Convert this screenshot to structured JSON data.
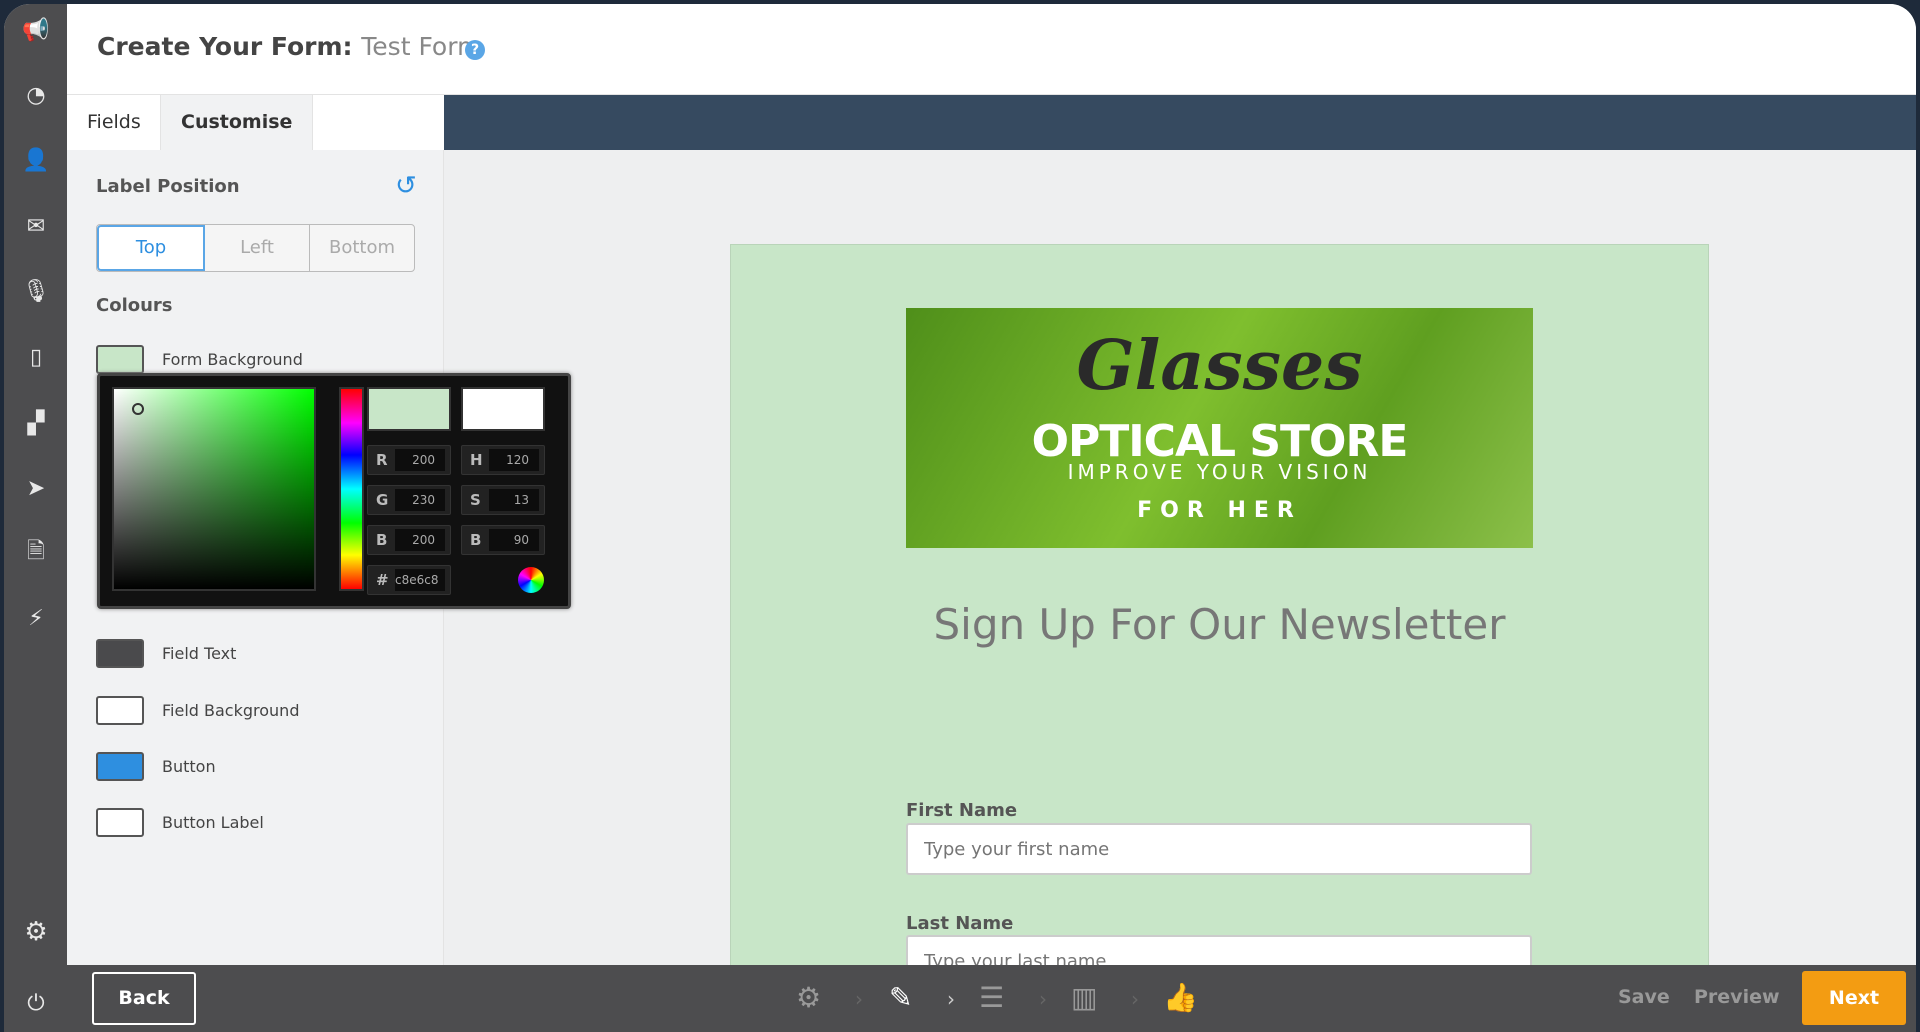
{
  "header": {
    "title": "Create Your Form:",
    "form_name": "Test Form",
    "help_icon": "?"
  },
  "tabs": [
    {
      "label": "Fields"
    },
    {
      "label": "Customise"
    }
  ],
  "label_position": {
    "heading": "Label Position",
    "options": [
      "Top",
      "Left",
      "Bottom"
    ],
    "selected": "Top"
  },
  "colours": {
    "heading": "Colours",
    "items": [
      {
        "label": "Form Background",
        "color": "#c8e6c8"
      },
      {
        "label": "Field Text",
        "color": "#4a4a4c"
      },
      {
        "label": "Field Background",
        "color": "#ffffff"
      },
      {
        "label": "Button",
        "color": "#2e8fe0"
      },
      {
        "label": "Button Label",
        "color": "#ffffff"
      }
    ]
  },
  "picker": {
    "R": "200",
    "G": "230",
    "B": "200",
    "H": "120",
    "S": "13",
    "Bv": "90",
    "hex": "c8e6c8",
    "new_color": "#c8e6c8",
    "old_color": "#ffffff",
    "labels": {
      "r": "R",
      "g": "G",
      "b": "B",
      "h": "H",
      "s": "S",
      "bv": "B",
      "hash": "#"
    }
  },
  "form": {
    "banner": {
      "script": "Glasses",
      "title": "OPTICAL STORE",
      "tagline": "IMPROVE YOUR VISION",
      "sub": "FOR HER"
    },
    "headline": "Sign Up For Our Newsletter",
    "fields": [
      {
        "label": "First Name",
        "placeholder": "Type your first name"
      },
      {
        "label": "Last Name",
        "placeholder": "Type your last name"
      }
    ]
  },
  "footer": {
    "back": "Back",
    "save": "Save",
    "preview": "Preview",
    "next": "Next"
  },
  "accent": "#2e8fe0",
  "brand": "#1abc9c"
}
